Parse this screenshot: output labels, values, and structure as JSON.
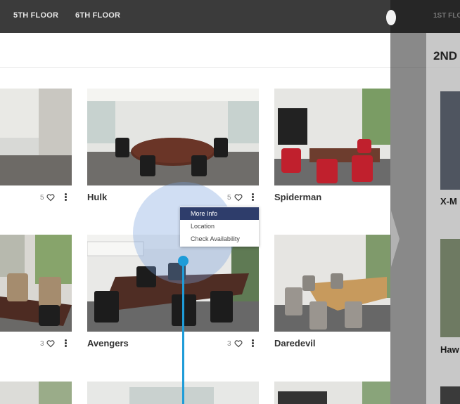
{
  "topbar": {
    "floor_tabs": [
      "5TH FLOOR",
      "6TH FLOOR"
    ]
  },
  "rooms": [
    {
      "name": "",
      "count": "5"
    },
    {
      "name": "Hulk",
      "count": "5"
    },
    {
      "name": "Spiderman",
      "count": ""
    },
    {
      "name": "",
      "count": "3"
    },
    {
      "name": "Avengers",
      "count": "3"
    },
    {
      "name": "Daredevil",
      "count": ""
    }
  ],
  "context_menu": {
    "items": [
      "More Info",
      "Location",
      "Check Availability"
    ]
  },
  "side_panel": {
    "tab": "1ST FLO",
    "heading": "2ND",
    "names": [
      "X-M",
      "Haw"
    ]
  },
  "colors": {
    "topbar": "#3b3b3b",
    "menu_active": "#2e3d6b",
    "touch_indicator": "#1e9cd8"
  },
  "icons": {
    "favorite": "heart-icon",
    "options": "kebab-menu-icon",
    "panel_arrow": "chevron-left-icon"
  }
}
